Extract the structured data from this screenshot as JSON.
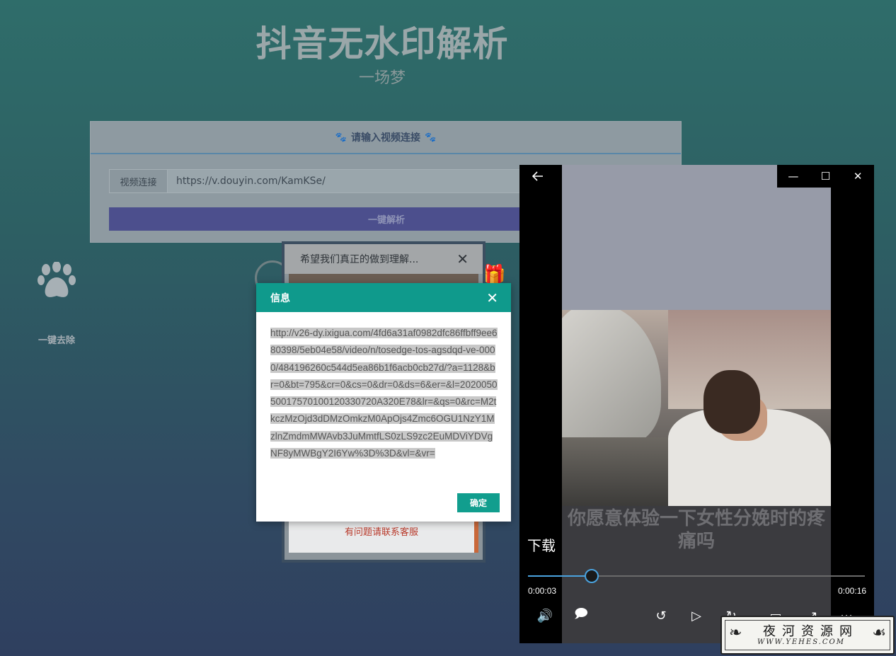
{
  "page": {
    "title": "抖音无水印解析",
    "subtitle": "一场梦"
  },
  "form": {
    "header": "请输入视频连接",
    "input_label": "视频连接",
    "input_value": "https://v.douyin.com/KamKSe/",
    "submit_label": "一键解析"
  },
  "features": {
    "remove_label": "一键去除"
  },
  "notice_dialog": {
    "title": "希望我们真正的做到理解...",
    "contact": "有问题请联系客服"
  },
  "info_dialog": {
    "title": "信息",
    "url": "http://v26-dy.ixigua.com/4fd6a31af0982dfc86ffbff9ee680398/5eb04e58/video/n/tosedge-tos-agsdqd-ve-0000/484196260c544d5ea86b1f6acb0cb27d/?a=1128&br=0&bt=795&cr=0&cs=0&dr=0&ds=6&er=&l=202005050017570100120330720A320E78&lr=&qs=0&rc=M2tkczMzOjd3dDMzOmkzM0ApOjs4Zmc6OGU1NzY1MzlnZmdmMWAvb3JuMmtfLS0zLS9zc2EuMDViYDVgNF8yMWBgY2I6Yw%3D%3D&vl=&vr=",
    "ok_label": "确定"
  },
  "player": {
    "download_label": "下载",
    "caption": "你愿意体验一下女性分娩时的疼痛吗",
    "current_time": "0:00:03",
    "total_time": "0:00:16",
    "progress": 0.19,
    "controls": [
      "volume-icon",
      "subtitles-icon",
      "skip-back-10-icon",
      "play-icon",
      "skip-forward-icon",
      "cast-icon",
      "fullscreen-icon",
      "more-icon"
    ]
  },
  "watermark": {
    "name": "夜河资源网",
    "url": "WWW.YEHES.COM"
  }
}
